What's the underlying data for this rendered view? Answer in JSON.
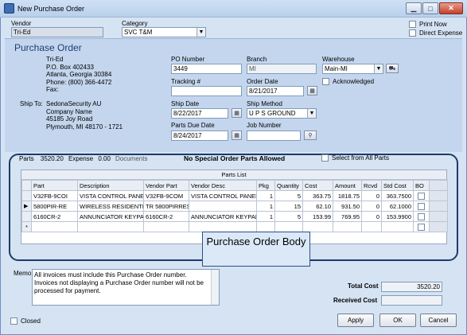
{
  "window": {
    "title": "New Purchase Order"
  },
  "top": {
    "vendor_label": "Vendor",
    "vendor_value": "Tri-Ed",
    "category_label": "Category",
    "category_value": "SVC T&M",
    "print_now_label": "Print Now",
    "direct_expense_label": "Direct Expense"
  },
  "header": {
    "title": "Purchase Order",
    "vendor_address": [
      "Tri-Ed",
      "P.O. Box 402433",
      "Atlanta, Georgia  30384",
      "Phone: (800) 366-4472",
      "Fax:"
    ],
    "ship_to_label": "Ship To:",
    "ship_to": [
      "SedonaSecurity AU",
      "Company Name",
      "45185 Joy Road",
      "Plymouth, MI  48170 - 1721"
    ],
    "po_number_label": "PO Number",
    "po_number": "3449",
    "branch_label": "Branch",
    "branch": "MI",
    "warehouse_label": "Warehouse",
    "warehouse": "Main-MI",
    "tracking_label": "Tracking #",
    "tracking": "",
    "order_date_label": "Order Date",
    "order_date": "8/21/2017",
    "acknowledged_label": "Acknowledged",
    "ship_date_label": "Ship Date",
    "ship_date": "8/22/2017",
    "ship_method_label": "Ship Method",
    "ship_method": "U P S GROUND",
    "parts_due_label": "Parts Due Date",
    "parts_due": "8/24/2017",
    "job_number_label": "Job Number",
    "job_number": ""
  },
  "tabs": {
    "parts_label": "Parts",
    "parts_total": "3520.20",
    "expense_label": "Expense",
    "expense_total": "0.00",
    "documents_label": "Documents",
    "notice": "No Special Order Parts Allowed",
    "select_all_label": "Select from All Parts"
  },
  "grid": {
    "title": "Parts List",
    "columns": [
      "Part",
      "Description",
      "Vendor Part",
      "Vendor Desc",
      "Pkg",
      "Quantity",
      "Cost",
      "Amount",
      "Rcvd",
      "Std Cost",
      "BO"
    ],
    "rows": [
      [
        "V32FB-9COI",
        "VISTA CONTROL PANEL",
        "V32FB-9COM",
        "VISTA CONTROL PANEL",
        "1",
        "5",
        "363.75",
        "1818.75",
        "0",
        "363.7500"
      ],
      [
        "5800PIR-RE",
        "WIRELESS RESIDENTIA",
        "TR 5800PIRRES",
        "",
        "1",
        "15",
        "62.10",
        "931.50",
        "0",
        "62.1000"
      ],
      [
        "6160CR-2",
        "ANNUNCIATOR KEYPAD",
        "6160CR-2",
        "ANNUNCIATOR KEYPAD",
        "1",
        "5",
        "153.99",
        "769.95",
        "0",
        "153.9900"
      ]
    ],
    "new_row_marker": "*",
    "current_row_marker": "▶"
  },
  "callout": {
    "text": "Purchase Order Body"
  },
  "memo": {
    "label": "Memo",
    "text": "All invoices must include this Purchase Order number.  Invoices not displaying a Purchase Order number will not be processed for payment."
  },
  "totals": {
    "total_cost_label": "Total Cost",
    "total_cost": "3520.20",
    "received_cost_label": "Received Cost",
    "received_cost": ""
  },
  "footer": {
    "closed_label": "Closed",
    "apply": "Apply",
    "ok": "OK",
    "cancel": "Cancel"
  },
  "colors": {
    "accent": "#1d3b6a",
    "background": "#c9d9ec"
  },
  "icons": [
    "app-icon",
    "calendar-icon",
    "truck-icon",
    "binoculars-icon",
    "minimize-icon",
    "maximize-icon",
    "close-icon"
  ]
}
